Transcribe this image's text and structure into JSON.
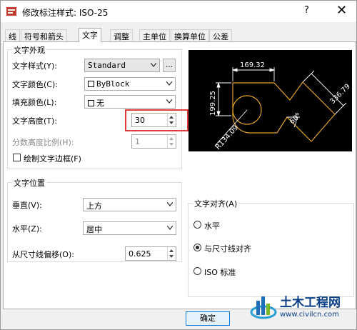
{
  "window": {
    "title": "修改标注样式: ISO-25",
    "help": "?",
    "close": "✕"
  },
  "tabs": [
    "线",
    "符号和箭头",
    "文字",
    "调整",
    "主单位",
    "换算单位",
    "公差"
  ],
  "text_appearance": {
    "title": "文字外观",
    "style_label": "文字样式(Y):",
    "style_value": "Standard",
    "style_button": "...",
    "color_label": "文字颜色(C):",
    "color_value": "ByBlock",
    "fill_label": "填充颜色(L):",
    "fill_value": "无",
    "height_label": "文字高度(T):",
    "height_value": "30",
    "fraction_label": "分数高度比例(H):",
    "fraction_value": "1",
    "frame_label": "绘制文字边框(F)"
  },
  "text_position": {
    "title": "文字位置",
    "vertical_label": "垂直(V):",
    "vertical_value": "上方",
    "horizontal_label": "水平(Z):",
    "horizontal_value": "居中",
    "offset_label": "从尺寸线偏移(O):",
    "offset_value": "0.625"
  },
  "text_alignment": {
    "title": "文字对齐(A)",
    "options": [
      "水平",
      "与尺寸线对齐",
      "ISO 标准"
    ],
    "selected": "与尺寸线对齐"
  },
  "preview": {
    "dim_top": "169.32",
    "dim_left": "199.25",
    "dim_right": "336.79",
    "angle": "60°",
    "radius": "R134.09"
  },
  "buttons": {
    "ok": "确定"
  },
  "watermark": {
    "text": "土木工程网",
    "url": "www.civilcn.com"
  },
  "colors": {
    "highlight": "#e03a3a",
    "preview_bg": "#000000",
    "preview_lines": "#e0a030",
    "dim_lines": "#ffffff"
  }
}
